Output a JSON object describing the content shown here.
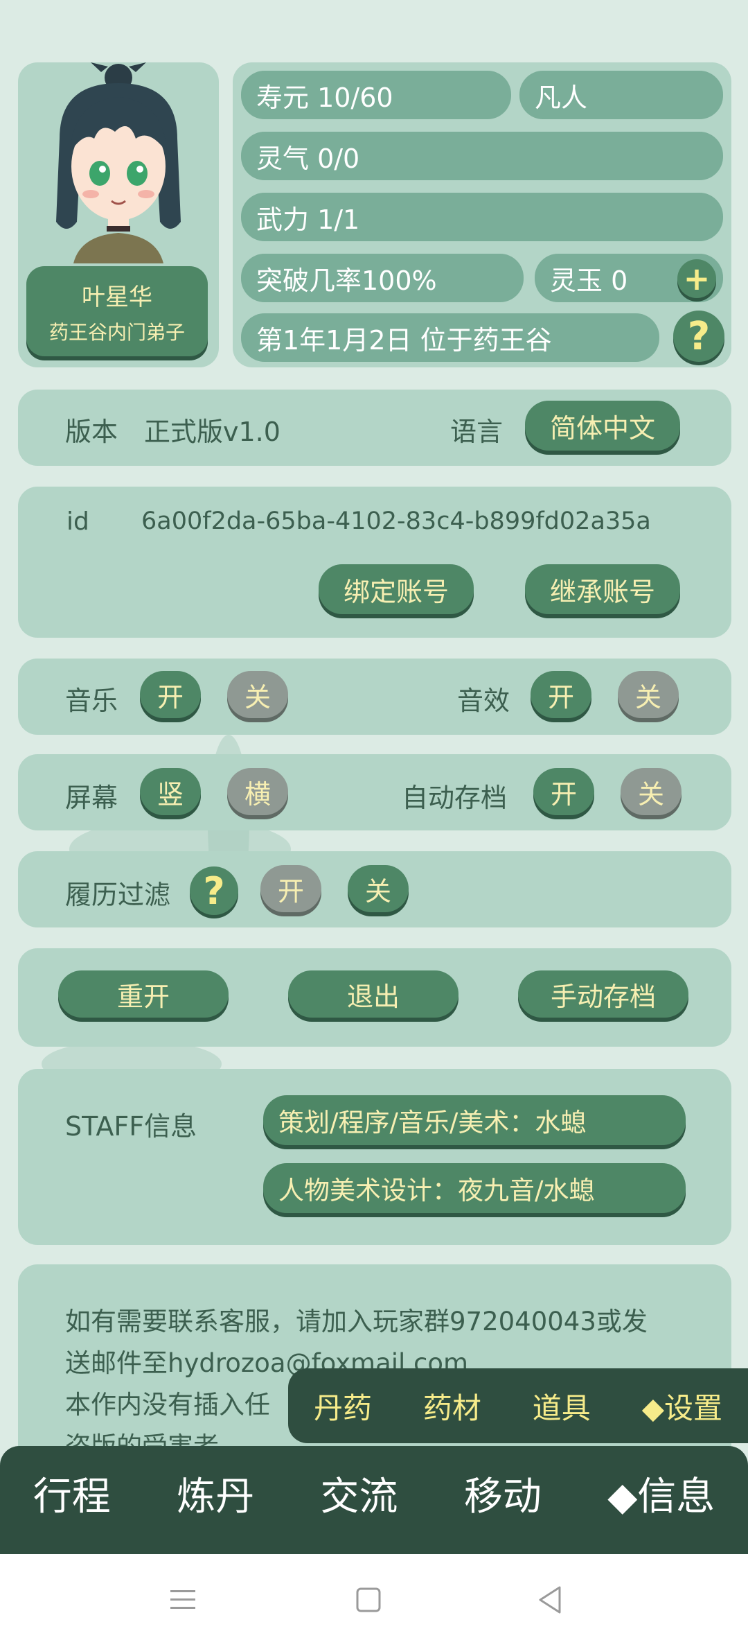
{
  "character": {
    "name": "叶星华",
    "title": "药王谷内门弟子",
    "stats": {
      "lifespan": "寿元 10/60",
      "realm": "凡人",
      "spirit": "灵气 0/0",
      "martial": "武力 1/1",
      "breakthrough": "突破几率100%",
      "jade": "灵玉 0",
      "date_location": "第1年1月2日 位于药王谷"
    }
  },
  "icons": {
    "help": "question-icon",
    "plus": "plus-icon"
  },
  "version": {
    "label": "版本",
    "value": "正式版v1.0",
    "language_label": "语言",
    "language_value": "简体中文"
  },
  "account": {
    "id_label": "id",
    "id_value": "6a00f2da-65ba-4102-83c4-b899fd02a35a",
    "bind": "绑定账号",
    "inherit": "继承账号"
  },
  "settings": {
    "music": {
      "label": "音乐",
      "on": "开",
      "off": "关"
    },
    "sfx": {
      "label": "音效",
      "on": "开",
      "off": "关"
    },
    "screen": {
      "label": "屏幕",
      "portrait": "竖",
      "landscape": "横"
    },
    "autosave": {
      "label": "自动存档",
      "on": "开",
      "off": "关"
    },
    "resume_filter": {
      "label": "履历过滤",
      "on": "开",
      "off": "关"
    }
  },
  "actions": {
    "restart": "重开",
    "exit": "退出",
    "manual_save": "手动存档"
  },
  "staff": {
    "label": "STAFF信息",
    "line1": "策划/程序/音乐/美术：水螅",
    "line2": "人物美术设计：夜九音/水螅"
  },
  "contact": {
    "line1": "如有需要联系客服，请加入玩家群972040043或发",
    "line2": "送邮件至hydrozoa@foxmail.com",
    "line3": "本作内没有插入任",
    "line4": "盗版的受害者"
  },
  "subnav": [
    "丹药",
    "药材",
    "道具",
    "◆设置"
  ],
  "mainnav": [
    "行程",
    "炼丹",
    "交流",
    "移动",
    "◆信息"
  ],
  "colors": {
    "primary_green": "#4e8766",
    "panel": "#b3d5c7",
    "text_yellow": "#f7efb2",
    "nav_dark": "#2f4e40"
  }
}
